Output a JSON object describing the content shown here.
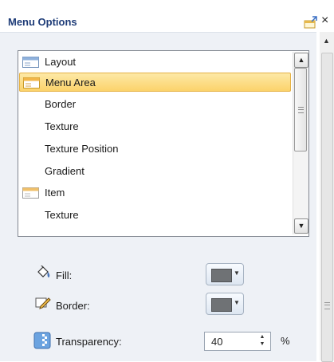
{
  "panel": {
    "title": "Menu Options",
    "pin_icon": "pin-icon",
    "close_glyph": "×"
  },
  "list": {
    "items": [
      {
        "label": "Layout",
        "icon": "layout-icon",
        "selected": false
      },
      {
        "label": "Menu Area",
        "icon": "menu-area-icon",
        "selected": true
      },
      {
        "label": "Border",
        "icon": "",
        "selected": false
      },
      {
        "label": "Texture",
        "icon": "",
        "selected": false
      },
      {
        "label": "Texture Position",
        "icon": "",
        "selected": false
      },
      {
        "label": "Gradient",
        "icon": "",
        "selected": false
      },
      {
        "label": "Item",
        "icon": "item-icon",
        "selected": false
      },
      {
        "label": "Texture",
        "icon": "",
        "selected": false
      }
    ]
  },
  "properties": {
    "fill_label": "Fill:",
    "border_label": "Border:",
    "transparency_label": "Transparency:",
    "transparency_value": "40",
    "transparency_unit": "%",
    "fill_color": "#6f7275",
    "border_color": "#6f7275"
  }
}
